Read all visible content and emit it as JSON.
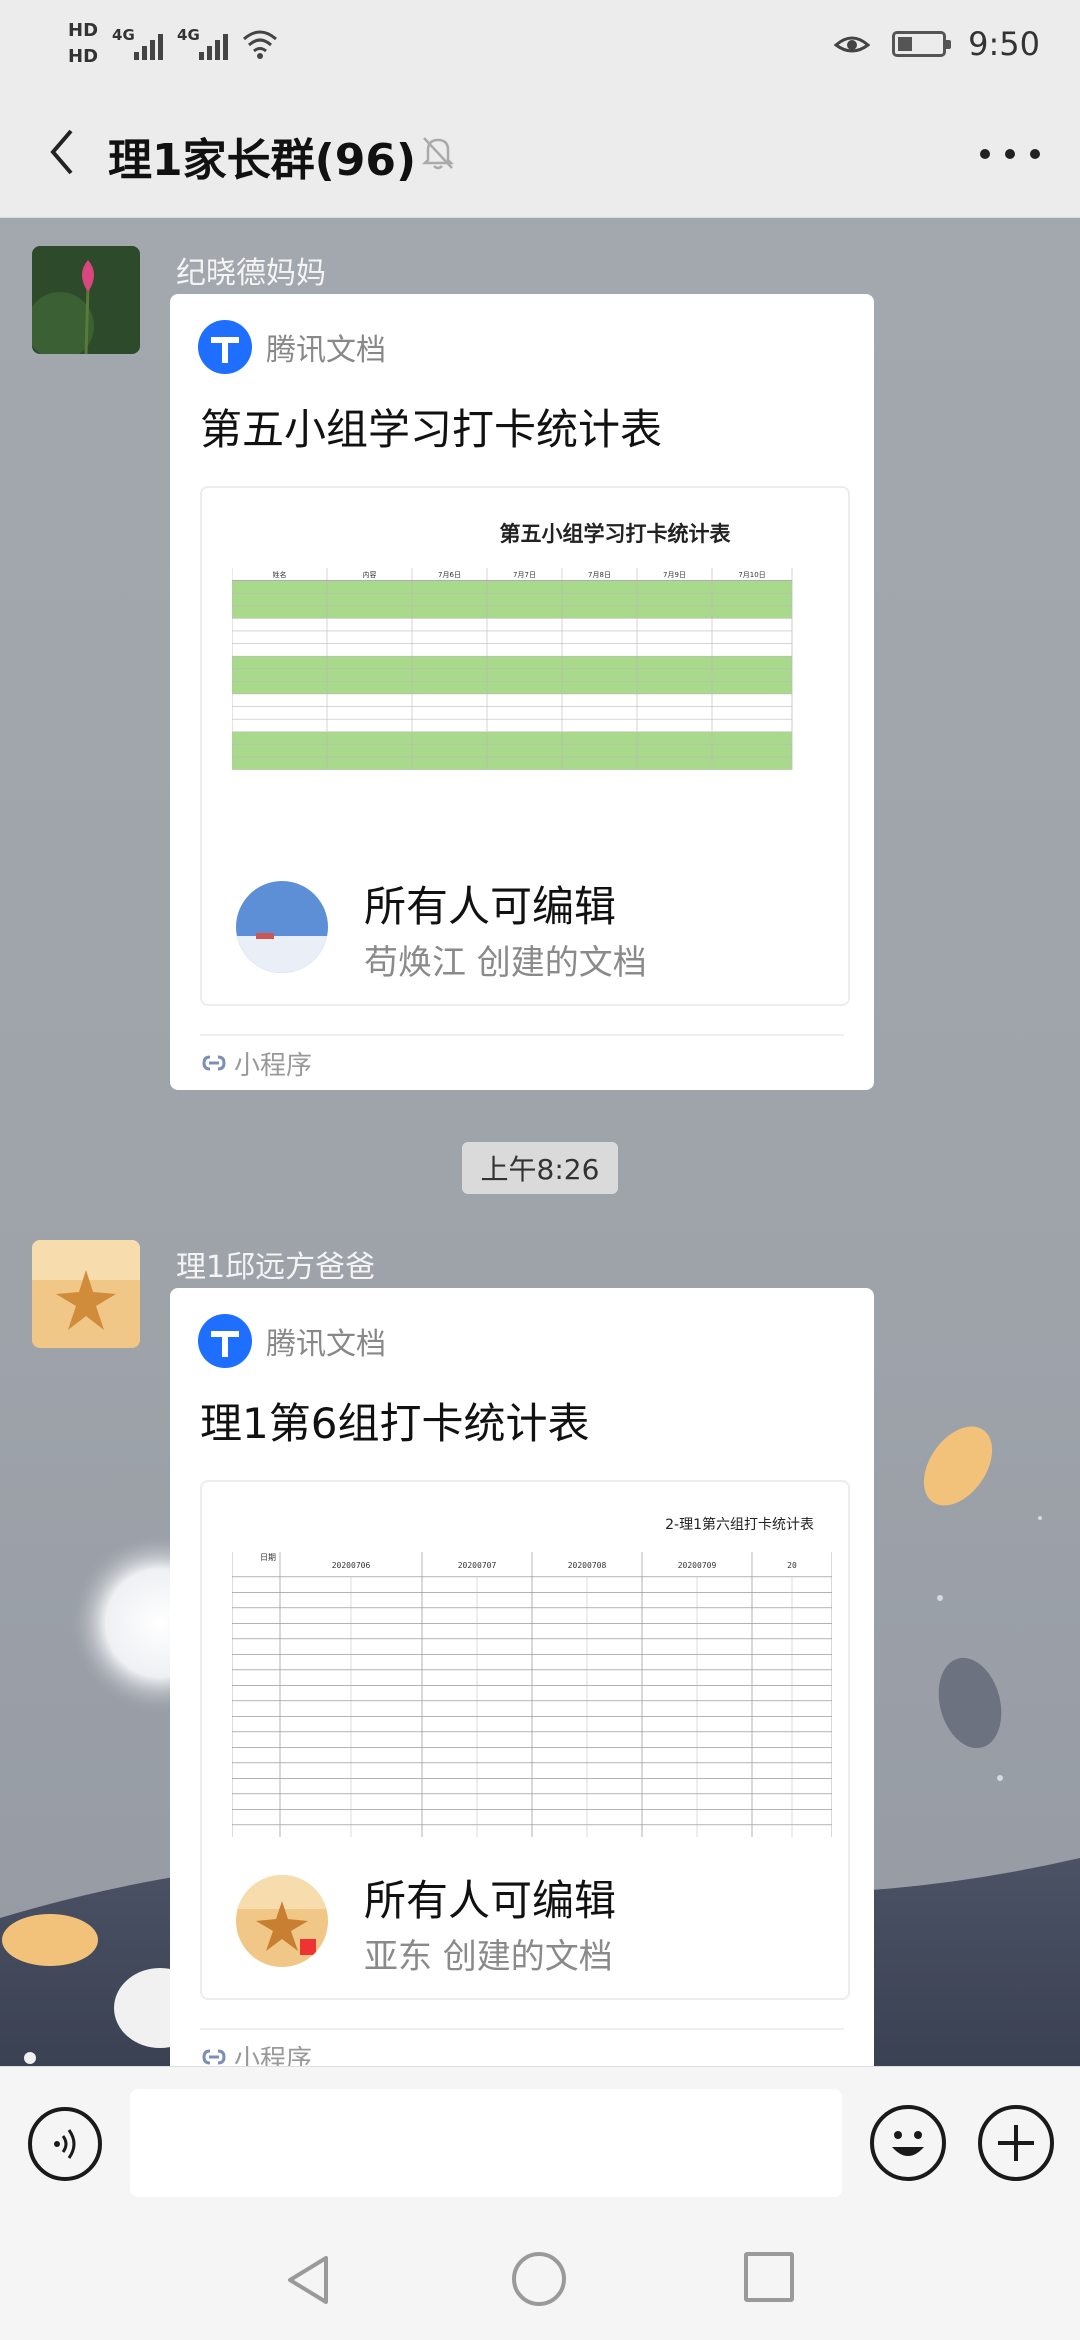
{
  "status_bar": {
    "hd1": "HD",
    "hd2": "HD",
    "net1": "4G",
    "net2": "4G",
    "time": "9:50"
  },
  "header": {
    "title": "理1家长群(96)"
  },
  "messages": [
    {
      "sender": "纪晓德妈妈",
      "card_source": "腾讯文档",
      "card_title": "第五小组学习打卡统计表",
      "preview_title": "第五小组学习打卡统计表",
      "permission": "所有人可编辑",
      "creator": "苟焕江 创建的文档",
      "footer": "小程序",
      "sheet_headers": [
        "姓名",
        "内容",
        "7月6日",
        "7月7日",
        "7月8日",
        "7月9日",
        "7月10日"
      ]
    },
    {
      "sender": "理1邱远方爸爸",
      "card_source": "腾讯文档",
      "card_title": "理1第6组打卡统计表",
      "preview_title": "2-理1第六组打卡统计表",
      "permission": "所有人可编辑",
      "creator": "亚东 创建的文档",
      "footer": "小程序",
      "sheet_headers": [
        "日期",
        "20200706",
        "20200707",
        "20200708",
        "20200709",
        "20"
      ]
    }
  ],
  "time_divider": "上午8:26",
  "input": {
    "placeholder": ""
  },
  "colors": {
    "accent": "#1e6fff",
    "chat_bg": "#a3a8ae",
    "sheet_green": "#a9d98a"
  }
}
